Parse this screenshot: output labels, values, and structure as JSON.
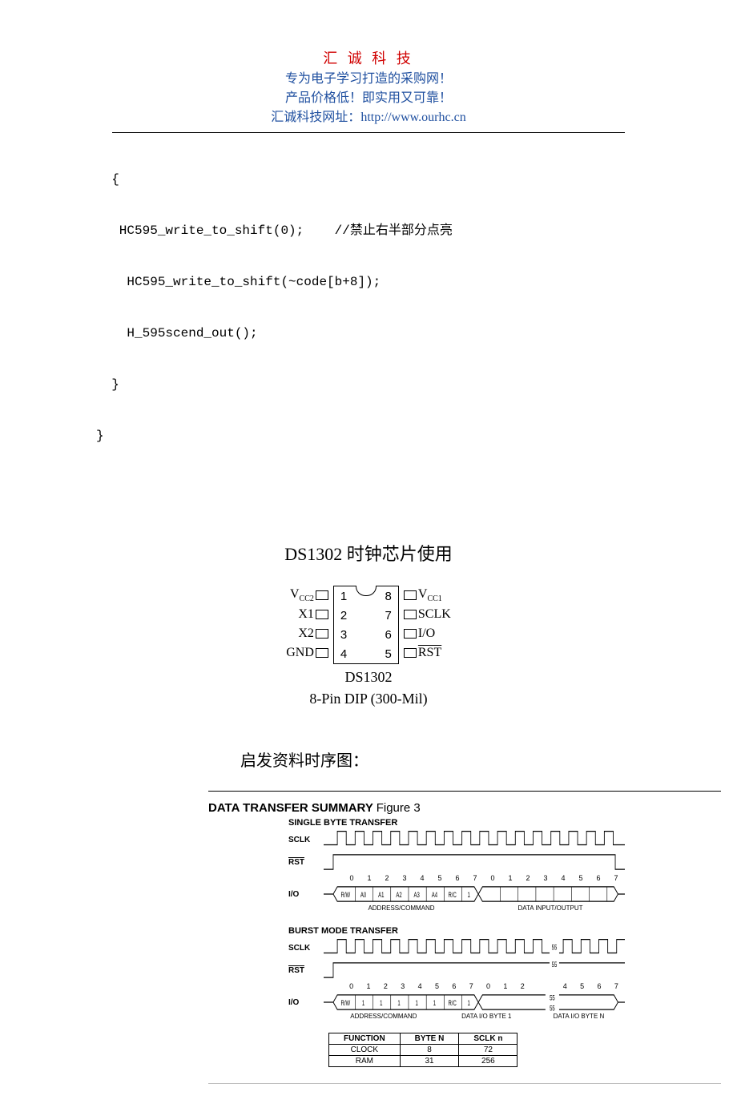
{
  "header": {
    "title": "汇 诚 科 技",
    "sub1": "专为电子学习打造的采购网！",
    "sub2": "产品价格低！即实用又可靠！",
    "url_prefix": "汇诚科技网址：",
    "url": "http://www.ourhc.cn"
  },
  "code": {
    "l1": "  {",
    "l2": "   HC595_write_to_shift(0);    //禁止右半部分点亮",
    "l3": "    HC595_write_to_shift(~code[b+8]);",
    "l4": "    H_595scend_out();",
    "l5": "  }",
    "l6": "}"
  },
  "section1_title": "DS1302 时钟芯片使用",
  "chip": {
    "pins_left": [
      "V",
      "X1",
      "X2",
      "GND"
    ],
    "vcc2_sub": "CC2",
    "nums_left": [
      "1",
      "2",
      "3",
      "4"
    ],
    "nums_right": [
      "8",
      "7",
      "6",
      "5"
    ],
    "pins_right_vcc1": "V",
    "vcc1_sub": "CC1",
    "pins_right": [
      "SCLK",
      "I/O",
      "RST"
    ],
    "caption1": "DS1302",
    "caption2": "8-Pin DIP (300-Mil)"
  },
  "section2_title": "启发资料时序图：",
  "timing": {
    "heading_bold": "DATA TRANSFER SUMMARY ",
    "heading_thin": "Figure 3",
    "single_title": "SINGLE BYTE TRANSFER",
    "burst_title": "BURST MODE TRANSFER",
    "sclk": "SCLK",
    "rst": "RST",
    "io": "I/O",
    "bits": [
      "0",
      "1",
      "2",
      "3",
      "4",
      "5",
      "6",
      "7",
      "0",
      "1",
      "2",
      "3",
      "4",
      "5",
      "6",
      "7"
    ],
    "io_cells": [
      "R/W",
      "A0",
      "A1",
      "A2",
      "A3",
      "A4",
      "R/C",
      "1"
    ],
    "io_cells_burst": [
      "R/W",
      "1",
      "1",
      "1",
      "1",
      "1",
      "R/C",
      "1"
    ],
    "addr_cmd": "ADDRESS/COMMAND",
    "data_io": "DATA INPUT/OUTPUT",
    "data_byte1": "DATA I/O BYTE 1",
    "data_byten": "DATA I/O BYTE N",
    "break55": "55"
  },
  "func_table": {
    "h1": "FUNCTION",
    "h2": "BYTE N",
    "h3": "SCLK n",
    "r1c1": "CLOCK",
    "r1c2": "8",
    "r1c3": "72",
    "r2c1": "RAM",
    "r2c2": "31",
    "r2c3": "256"
  }
}
